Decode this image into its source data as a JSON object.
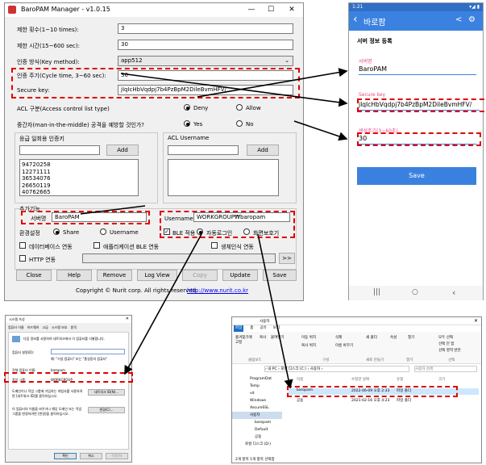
{
  "main": {
    "title": "BaroPAM Manager - v1.0.15",
    "min_glyph": "—",
    "max_glyph": "☐",
    "close_glyph": "✕",
    "limit_count_label": "제한 횟수(1~10 times):",
    "limit_count_value": "3",
    "limit_time_label": "제한 시간(15~600 sec):",
    "limit_time_value": "30",
    "auth_method_label": "인증 방식(Key method):",
    "auth_method_value": "app512",
    "cycle_label": "인증 주기(Cycle time, 3~60 sec):",
    "cycle_value": "30",
    "secure_key_label": "Secure key:",
    "secure_key_value": "jIqIcHbVqdpj7b4PzBpM2DileBvmHFV/",
    "acl_label": "ACL 구분(Access control list type)",
    "acl_deny": "Deny",
    "acl_allow": "Allow",
    "mitm_label": "중간자(man-in-the-middle) 공격을 예방할 것인가?",
    "mitm_yes": "Yes",
    "mitm_no": "No",
    "emergency_label": "응급 일회용 인증키",
    "emergency_add": "Add",
    "emergency_keys": [
      "94720258",
      "12271111",
      "36534076",
      "26650119",
      "40762665"
    ],
    "acl_username_label": "ACL Username",
    "acl_add": "Add",
    "extra_label": "추가기능",
    "server_name_label": "서버명",
    "server_name_value": "BaroPAM",
    "env_label": "환경설정",
    "env_share": "Share",
    "env_username": "Username",
    "username_label": "Username",
    "username_value": "WORKGROUP₩baropam",
    "ble_label": "BLE 적용",
    "auto_login": "자동로그인",
    "screen_saver": "화면보호기",
    "db_link": "데이터베이스 연동",
    "app_ble_link": "애플리케이션 BLE 연동",
    "bio_link": "생체인식 연동",
    "http_link": "HTTP 연동",
    "more": ">>",
    "buttons": [
      "Close",
      "Help",
      "Remove",
      "Log View",
      "Copy",
      "Update",
      "Save"
    ],
    "copyright": "Copyright © Nurit corp. All rights reserved.",
    "copyright_link": "http://www.nurit.co.kr"
  },
  "phone": {
    "time": "1:21",
    "status_right": "▾◢ ▮",
    "back": "‹",
    "title": "바로팜",
    "share_icon": "<",
    "gear_icon": "⚙",
    "section": "서버 정보 등록",
    "server_name_label": "서버명",
    "server_name_value": "BaroPAM",
    "secure_key_label": "Secure key",
    "secure_key_value": "jIqIcHbVqdpj7b4PzBpM2DileBvmHFV/",
    "cycle_label": "생성주기(3~60초)",
    "cycle_value": "30",
    "save": "Save",
    "nav": [
      "|||",
      "○",
      "‹"
    ]
  },
  "system_dialog": {
    "title": "시스템 속성",
    "tabs": [
      "컴퓨터 이름",
      "하드웨어",
      "고급",
      "시스템 보호",
      "원격"
    ],
    "desc": "다음 정보를 사용하여 네트워크에서 이 컴퓨터를 식별합니다.",
    "computer_desc_label": "컴퓨터 설명(D):",
    "example": "예: \"거실 컴퓨터\" 또는 \"홍길동의 컴퓨터\"",
    "full_name_label": "전체 컴퓨터 이름:",
    "full_name_value": "baropam",
    "workgroup_label": "작업 그룹:",
    "workgroup_value": "WORKGROUP",
    "wizard_text": "도메인이나 작업 그룹에 가입하는 마법사를 사용하려면 [네트워크 ID]를 클릭하십시오.",
    "network_id": "네트워크 ID(N)...",
    "rename_text": "이 컴퓨터의 이름을 바꾸거나 해당 도메인 또는 작업 그룹을 변경하려면 [변경]을 클릭하십시오.",
    "change": "변경(C)...",
    "ok": "확인",
    "cancel": "취소",
    "apply": "적용(A)"
  },
  "explorer": {
    "title": "사용자",
    "menu": [
      "파일",
      "홈",
      "공유",
      "보기"
    ],
    "ribbon": [
      "즐겨찾기에 고정",
      "복사",
      "붙여넣기",
      "이동 위치",
      "복사 위치",
      "삭제",
      "이름 바꾸기",
      "새 폴더",
      "속성",
      "열기",
      "모두 선택",
      "선택 안 함",
      "선택 영역 반전"
    ],
    "ribbon_groups": [
      "클립보드",
      "구성",
      "새로 만들기",
      "열기",
      "선택"
    ],
    "path": "› 내 PC › 로컬 디스크 (C:) › 사용자 ›",
    "search": "사용자 검색",
    "columns": [
      "이름",
      "수정한 날짜",
      "유형",
      "크기"
    ],
    "rows": [
      {
        "name": "baropam",
        "date": "2022-06-09 오후 2:33",
        "type": "파일 폴더"
      },
      {
        "name": "공용",
        "date": "2021-02-16 오후 4:23",
        "type": "파일 폴더"
      }
    ],
    "tree": [
      "ProgramDat",
      "Temp",
      "vd",
      "Windows",
      "XecureSSL",
      "사용자",
      "baropam",
      "Default",
      "공용",
      "로컬 디스크 (D:)"
    ],
    "status": "2개 항목   1개 항목 선택함"
  },
  "colors": {
    "highlight": "#e00000",
    "phone_blue": "#3b82e0",
    "phone_button": "#3b82e0"
  }
}
